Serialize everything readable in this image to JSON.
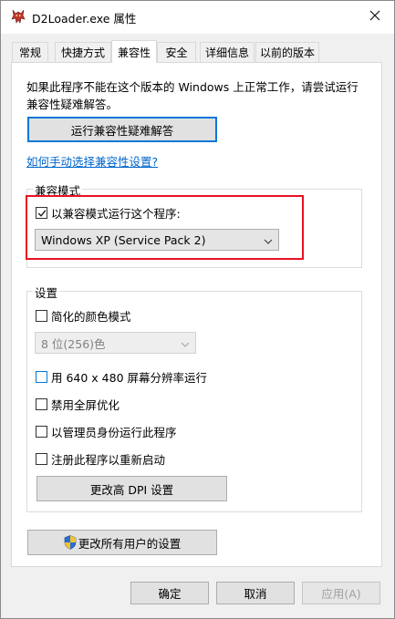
{
  "window": {
    "title": "D2Loader.exe 属性",
    "app_icon": "devil-app-icon",
    "close_icon": "close-icon"
  },
  "tabs": [
    {
      "label": "常规"
    },
    {
      "label": "快捷方式"
    },
    {
      "label": "兼容性",
      "active": true
    },
    {
      "label": "安全"
    },
    {
      "label": "详细信息"
    },
    {
      "label": "以前的版本"
    }
  ],
  "compat": {
    "intro": "如果此程序不能在这个版本的 Windows 上正常工作，请尝试运行兼容性疑难解答。",
    "troubleshooter_button": "运行兼容性疑难解答",
    "manual_link": "如何手动选择兼容性设置?",
    "mode_group_title": "兼容模式",
    "mode_checkbox_label": "以兼容模式运行这个程序:",
    "mode_checkbox_checked": true,
    "mode_select_value": "Windows XP (Service Pack 2)"
  },
  "settings": {
    "group_title": "设置",
    "reduced_color_label": "简化的颜色模式",
    "reduced_color_checked": false,
    "color_select_value": "8 位(256)色",
    "resolution_label": "用 640 x 480 屏幕分辨率运行",
    "fullscreen_label": "禁用全屏优化",
    "admin_label": "以管理员身份运行此程序",
    "restart_label": "注册此程序以重新启动",
    "dpi_button": "更改高 DPI 设置"
  },
  "all_users_button": "更改所有用户的设置",
  "footer": {
    "ok": "确定",
    "cancel": "取消",
    "apply": "应用(A)"
  },
  "colors": {
    "highlight_border": "#e81123",
    "focus_blue": "#0078d7",
    "link": "#0066cc"
  }
}
